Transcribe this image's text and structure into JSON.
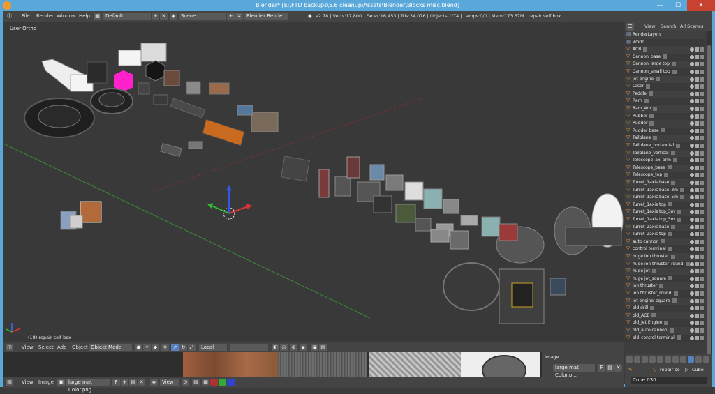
{
  "window": {
    "title": "Blender* [E:\\FTD backups\\5.6 cleanup\\Assets\\Blender\\Blocks misc.blend]",
    "minimize": "—",
    "maximize": "☐",
    "close": "✕"
  },
  "info_header": {
    "menus": [
      "File",
      "Render",
      "Window",
      "Help"
    ],
    "screen_layout": "Default",
    "scene": "Scene",
    "render_engine": "Blender Render",
    "stats": "v2.78 | Verts:17,800 | Faces:16,453 | Tris:34,076 | Objects:1/74 | Lamps:0/0 | Mem:173.67M | repair self box"
  },
  "viewport": {
    "view_label": "User Ortho",
    "selected_label": "(18) repair self box"
  },
  "view3d_header": {
    "menus": [
      "View",
      "Select",
      "Add",
      "Object"
    ],
    "mode": "Object Mode",
    "orientation": "Local"
  },
  "image_editor_header": {
    "menus": [
      "View",
      "Image"
    ],
    "image_name": "large mat Color.png",
    "view_menu": "View"
  },
  "image_panel": {
    "title": "Image",
    "image_name": "large mat Color.p..."
  },
  "outliner": {
    "tabs": [
      "View",
      "Search",
      "All Scenes"
    ],
    "items": [
      {
        "name": "RenderLayers",
        "icon": "renderlayers-icon"
      },
      {
        "name": "World",
        "icon": "world-icon"
      },
      {
        "name": "ACB",
        "icon": "object-icon"
      },
      {
        "name": "Cannon_base",
        "icon": "object-icon"
      },
      {
        "name": "Cannon_large top",
        "icon": "object-icon"
      },
      {
        "name": "Cannon_small top",
        "icon": "object-icon"
      },
      {
        "name": "jet engine",
        "icon": "object-icon"
      },
      {
        "name": "Laser",
        "icon": "object-icon"
      },
      {
        "name": "Paddle",
        "icon": "object-icon"
      },
      {
        "name": "Ram",
        "icon": "object-icon"
      },
      {
        "name": "Ram_4m",
        "icon": "object-icon"
      },
      {
        "name": "Rubber",
        "icon": "object-icon"
      },
      {
        "name": "Rudder",
        "icon": "object-icon"
      },
      {
        "name": "Rudder base",
        "icon": "object-icon"
      },
      {
        "name": "Tailplane",
        "icon": "object-icon"
      },
      {
        "name": "Tailplane_horizontal",
        "icon": "object-icon"
      },
      {
        "name": "Tailplane_vertical",
        "icon": "object-icon"
      },
      {
        "name": "Telescope_axi arm",
        "icon": "object-icon"
      },
      {
        "name": "Telescope_base",
        "icon": "object-icon"
      },
      {
        "name": "Telescope_top",
        "icon": "object-icon"
      },
      {
        "name": "Turret_1axis base",
        "icon": "object-icon"
      },
      {
        "name": "Turret_1axis base_3m",
        "icon": "object-icon"
      },
      {
        "name": "Turret_1axis base_5m",
        "icon": "object-icon"
      },
      {
        "name": "Turret_1axis top",
        "icon": "object-icon"
      },
      {
        "name": "Turret_1axis top_3m",
        "icon": "object-icon"
      },
      {
        "name": "Turret_1axis top_5m",
        "icon": "object-icon"
      },
      {
        "name": "Turret_2axis base",
        "icon": "object-icon"
      },
      {
        "name": "Turret_2axis top",
        "icon": "object-icon"
      },
      {
        "name": "auto cannon",
        "icon": "object-icon"
      },
      {
        "name": "control terminal",
        "icon": "object-icon"
      },
      {
        "name": "huge ion thruster",
        "icon": "object-icon"
      },
      {
        "name": "huge ion thruster_round",
        "icon": "object-icon"
      },
      {
        "name": "huge jet",
        "icon": "object-icon"
      },
      {
        "name": "huge jet_square",
        "icon": "object-icon"
      },
      {
        "name": "ion thruster",
        "icon": "object-icon"
      },
      {
        "name": "ion thruster_round",
        "icon": "object-icon"
      },
      {
        "name": "jet engine_square",
        "icon": "object-icon"
      },
      {
        "name": "old drill",
        "icon": "object-icon"
      },
      {
        "name": "old_ACB",
        "icon": "object-icon"
      },
      {
        "name": "old_Jet Engine",
        "icon": "object-icon"
      },
      {
        "name": "old_auto cannon",
        "icon": "object-icon"
      },
      {
        "name": "old_control terminal",
        "icon": "object-icon"
      }
    ]
  },
  "properties": {
    "context_label": "repair se",
    "cube_label": "Cube",
    "mesh_name": "Cube.030"
  },
  "colors": {
    "title_bar": "#5aa7d9",
    "close_button": "#c7422f",
    "header_bg": "#444444",
    "viewport_bg": "#393939",
    "object_icon": "#e8a040",
    "selected_magenta": "#ff22cc",
    "axis_x": "#b03030",
    "axis_y": "#3a8a3a"
  }
}
